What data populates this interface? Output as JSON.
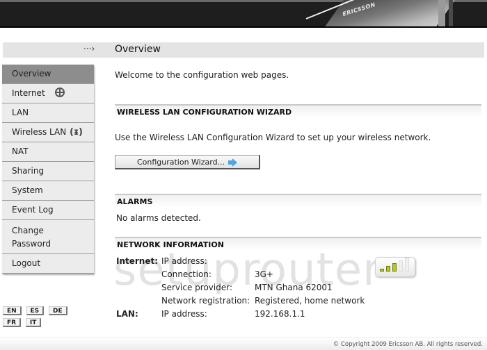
{
  "header": {
    "brand": "ERICSSON"
  },
  "titlebar": {
    "arrow_icon": "dotted-arrow-icon",
    "title": "Overview"
  },
  "sidebar": {
    "items": [
      {
        "label": "Overview",
        "active": true
      },
      {
        "label": "Internet",
        "icon": "globe-icon"
      },
      {
        "label": "LAN"
      },
      {
        "label": "Wireless LAN",
        "icon": "antenna-icon"
      },
      {
        "label": "NAT"
      },
      {
        "label": "Sharing"
      },
      {
        "label": "System"
      },
      {
        "label": "Event Log"
      },
      {
        "label": "Change",
        "label2": "Password"
      },
      {
        "label": "Logout"
      }
    ]
  },
  "languages": [
    "EN",
    "ES",
    "DE",
    "FR",
    "IT"
  ],
  "main": {
    "welcome": "Welcome to the configuration web pages.",
    "wizard": {
      "heading": "WIRELESS LAN CONFIGURATION WIZARD",
      "text": "Use the Wireless LAN Configuration Wizard to set up your wireless network.",
      "button_label": "Configuration Wizard...",
      "button_icon": "arrow-right-icon"
    },
    "alarms": {
      "heading": "ALARMS",
      "text": "No alarms detected."
    },
    "network": {
      "heading": "NETWORK INFORMATION",
      "internet_label": "Internet:",
      "lan_label": "LAN:",
      "rows": [
        {
          "label": "IP address:",
          "value": ""
        },
        {
          "label": "Connection:",
          "value": "3G+"
        },
        {
          "label": "Service provider:",
          "value": "MTN Ghana 62001"
        },
        {
          "label": "Network registration:",
          "value": "Registered, home network"
        },
        {
          "label": "IP address:",
          "value": "192.168.1.1"
        }
      ],
      "signal_strength": {
        "bars_on": 3,
        "bars_total": 5,
        "color": "#b8c81e"
      }
    }
  },
  "watermark": "setuprouter",
  "footer": {
    "copyright": "© Copyright 2009 Ericsson AB. All rights reserved."
  }
}
